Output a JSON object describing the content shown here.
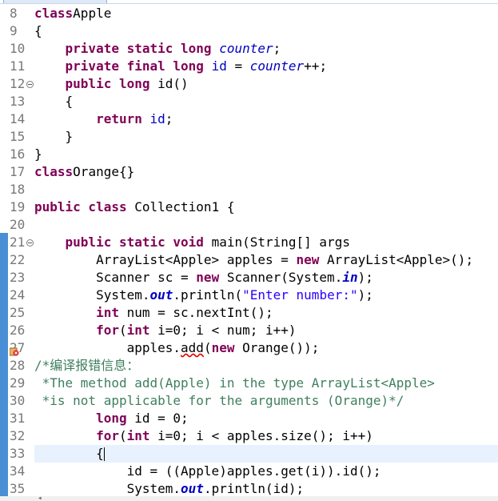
{
  "lines": [
    {
      "no": "8",
      "t": [
        [
          "kw",
          "class"
        ],
        [
          "",
          "Apple"
        ]
      ]
    },
    {
      "no": "9",
      "t": [
        [
          "",
          "{"
        ]
      ]
    },
    {
      "no": "10",
      "t": [
        [
          "",
          "    "
        ],
        [
          "kw",
          "private static long "
        ],
        [
          "sfld",
          "counter"
        ],
        [
          "",
          ";"
        ]
      ]
    },
    {
      "no": "11",
      "t": [
        [
          "",
          "    "
        ],
        [
          "kw",
          "private final long "
        ],
        [
          "fld",
          "id"
        ],
        [
          "",
          " = "
        ],
        [
          "sfld",
          "counter"
        ],
        [
          "",
          "++;"
        ]
      ]
    },
    {
      "no": "12",
      "fold": true,
      "t": [
        [
          "",
          "    "
        ],
        [
          "kw",
          "public long "
        ],
        [
          "",
          "id()"
        ]
      ]
    },
    {
      "no": "13",
      "t": [
        [
          "",
          "    {"
        ]
      ]
    },
    {
      "no": "14",
      "t": [
        [
          "",
          "        "
        ],
        [
          "kw",
          "return "
        ],
        [
          "fld",
          "id"
        ],
        [
          "",
          ";"
        ]
      ]
    },
    {
      "no": "15",
      "t": [
        [
          "",
          "    }"
        ]
      ]
    },
    {
      "no": "16",
      "t": [
        [
          "",
          "}"
        ]
      ]
    },
    {
      "no": "17",
      "t": [
        [
          "kw",
          "class"
        ],
        [
          "",
          "Orange{}"
        ]
      ]
    },
    {
      "no": "18",
      "t": []
    },
    {
      "no": "19",
      "t": [
        [
          "kw",
          "public class "
        ],
        [
          "",
          "Collection1 {"
        ]
      ]
    },
    {
      "no": "20",
      "t": []
    },
    {
      "no": "21",
      "fold": true,
      "t": [
        [
          "",
          "    "
        ],
        [
          "kw",
          "public static void "
        ],
        [
          "",
          "main(String[] "
        ],
        [
          "",
          "args"
        ],
        [
          ") {"
        ]
      ]
    },
    {
      "no": "22",
      "t": [
        [
          "",
          "        ArrayList<Apple> apples = "
        ],
        [
          "kw",
          "new "
        ],
        [
          "",
          "ArrayList<Apple>();"
        ]
      ]
    },
    {
      "no": "23",
      "t": [
        [
          "",
          "        Scanner sc = "
        ],
        [
          "kw",
          "new "
        ],
        [
          "",
          "Scanner(System."
        ],
        [
          "sfin",
          "in"
        ],
        [
          "",
          ");"
        ]
      ]
    },
    {
      "no": "24",
      "t": [
        [
          "",
          "        System."
        ],
        [
          "sfin",
          "out"
        ],
        [
          "",
          ".println("
        ],
        [
          "str",
          "\"Enter number:\""
        ],
        [
          "",
          ");"
        ]
      ]
    },
    {
      "no": "25",
      "t": [
        [
          "",
          "        "
        ],
        [
          "kw",
          "int "
        ],
        [
          "",
          "num = sc.nextInt();"
        ]
      ]
    },
    {
      "no": "26",
      "t": [
        [
          "",
          "        "
        ],
        [
          "kw",
          "for"
        ],
        [
          "",
          "("
        ],
        [
          "kw",
          "int "
        ],
        [
          "",
          "i=0; i < num; i++)"
        ]
      ]
    },
    {
      "no": "27",
      "error": true,
      "t": [
        [
          "",
          "            apples."
        ],
        [
          "err",
          "add"
        ],
        [
          "",
          "("
        ],
        [
          "kw",
          "new "
        ],
        [
          "",
          "Orange());"
        ]
      ]
    },
    {
      "no": "28",
      "t": [
        [
          "cmt",
          "/*编译报错信息："
        ]
      ]
    },
    {
      "no": "29",
      "t": [
        [
          "cmt",
          " *The method add(Apple) in the type ArrayList<Apple>"
        ]
      ]
    },
    {
      "no": "30",
      "t": [
        [
          "cmt",
          " *is not applicable for the arguments (Orange)*/"
        ]
      ]
    },
    {
      "no": "31",
      "t": [
        [
          "",
          "        "
        ],
        [
          "kw",
          "long "
        ],
        [
          "",
          "id = 0;"
        ]
      ]
    },
    {
      "no": "32",
      "t": [
        [
          "",
          "        "
        ],
        [
          "kw",
          "for"
        ],
        [
          "",
          "("
        ],
        [
          "kw",
          "int "
        ],
        [
          "",
          "i=0; i < apples.size(); i++)"
        ]
      ]
    },
    {
      "no": "33",
      "current": true,
      "t": [
        [
          "",
          "        {"
        ]
      ]
    },
    {
      "no": "34",
      "t": [
        [
          "",
          "            id = ((Apple)apples.get(i)).id();"
        ]
      ]
    },
    {
      "no": "35",
      "t": [
        [
          "",
          "            System."
        ],
        [
          "sfin",
          "out"
        ],
        [
          "",
          ".println(id);"
        ]
      ]
    }
  ]
}
